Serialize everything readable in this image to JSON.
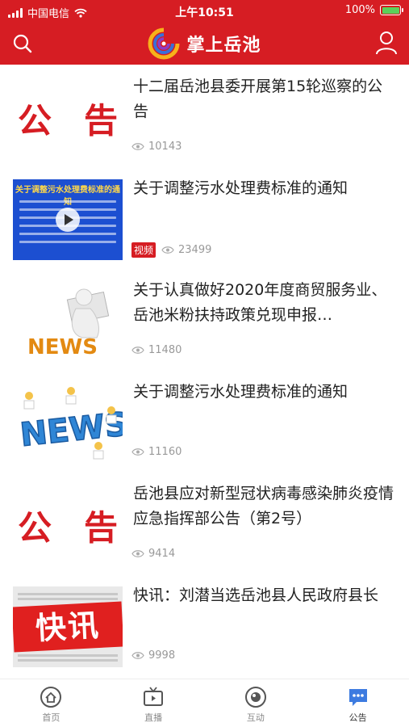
{
  "status_bar": {
    "carrier": "中国电信",
    "time": "上午10:51",
    "battery": "100%",
    "battery_level": 1.0
  },
  "nav": {
    "title": "掌上岳池",
    "icons": {
      "left": "search-icon",
      "right": "user-icon"
    },
    "brand_color": "#d61d23"
  },
  "feed": {
    "items": [
      {
        "title": "十二届岳池县委开展第15轮巡察的公告",
        "views": "10143",
        "thumb": {
          "type": "notice",
          "text": "公告"
        }
      },
      {
        "title": "关于调整污水处理费标准的通知",
        "views": "23499",
        "tag": "视频",
        "thumb": {
          "type": "video",
          "caption": "关于调整污水处理费标准的通知"
        }
      },
      {
        "title": "关于认真做好2020年度商贸服务业、岳池米粉扶持政策兑现申报…",
        "views": "11480",
        "thumb": {
          "type": "news-reader",
          "text": "NEWS"
        }
      },
      {
        "title": "关于调整污水处理费标准的通知",
        "views": "11160",
        "thumb": {
          "type": "news-3d",
          "text": "NEWS"
        }
      },
      {
        "title": "岳池县应对新型冠状病毒感染肺炎疫情 应急指挥部公告（第2号）",
        "views": "9414",
        "thumb": {
          "type": "notice",
          "text": "公告"
        }
      },
      {
        "title": "快讯：刘潜当选岳池县人民政府县长",
        "views": "9998",
        "thumb": {
          "type": "flash",
          "text": "快讯"
        }
      }
    ]
  },
  "tabbar": {
    "tabs": [
      {
        "label": "首页",
        "icon": "home-icon",
        "active": false
      },
      {
        "label": "直播",
        "icon": "tv-icon",
        "active": false
      },
      {
        "label": "互动",
        "icon": "interact-icon",
        "active": false
      },
      {
        "label": "公告",
        "icon": "message-icon",
        "active": true
      }
    ],
    "active_color": "#3d7be0"
  }
}
